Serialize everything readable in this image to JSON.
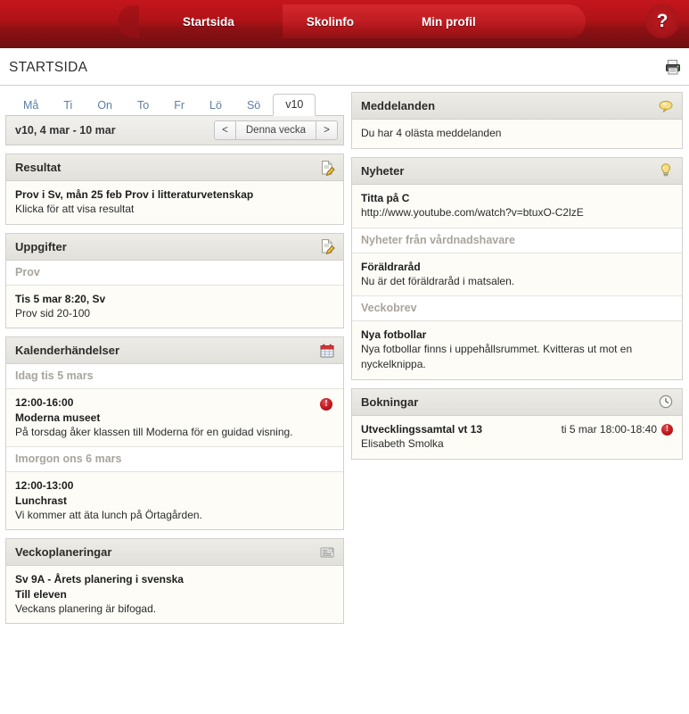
{
  "topnav": {
    "items": [
      {
        "label": "Startsida",
        "active": true
      },
      {
        "label": "Skolinfo",
        "active": false
      },
      {
        "label": "Min profil",
        "active": false
      }
    ],
    "help_label": "?"
  },
  "page": {
    "title": "STARTSIDA",
    "print_icon": "printer-icon"
  },
  "daytabs": {
    "items": [
      {
        "label": "Må"
      },
      {
        "label": "Ti"
      },
      {
        "label": "On"
      },
      {
        "label": "To"
      },
      {
        "label": "Fr"
      },
      {
        "label": "Lö"
      },
      {
        "label": "Sö"
      },
      {
        "label": "v10"
      }
    ]
  },
  "weekbar": {
    "label": "v10, 4 mar - 10 mar",
    "prev": "<",
    "current": "Denna vecka",
    "next": ">"
  },
  "panels": {
    "resultat": {
      "title": "Resultat",
      "icon": "edit-document-icon",
      "item_title": "Prov i Sv, mån 25 feb Prov i litteraturvetenskap",
      "item_text": "Klicka för att visa resultat"
    },
    "uppgifter": {
      "title": "Uppgifter",
      "icon": "edit-document-icon",
      "group_label": "Prov",
      "item_title": "Tis 5 mar 8:20, Sv",
      "item_text": "Prov sid 20-100"
    },
    "kalender": {
      "title": "Kalenderhändelser",
      "icon": "calendar-icon",
      "groups": [
        {
          "label": "Idag tis 5 mars",
          "events": [
            {
              "time": "12:00-16:00",
              "title": "Moderna museet",
              "text": "På torsdag åker klassen till Moderna för en guidad visning.",
              "badge": "!"
            }
          ]
        },
        {
          "label": "Imorgon ons 6 mars",
          "events": [
            {
              "time": "12:00-13:00",
              "title": "Lunchrast",
              "text": "Vi kommer att äta lunch på Örtagården.",
              "badge": ""
            }
          ]
        }
      ]
    },
    "veckoplaneringar": {
      "title": "Veckoplaneringar",
      "icon": "planning-document-icon",
      "item_title": "Sv 9A - Årets planering i svenska",
      "item_sub": "Till eleven",
      "item_text": "Veckans planering är bifogad."
    },
    "meddelanden": {
      "title": "Meddelanden",
      "icon": "speech-bubble-icon",
      "item_text": "Du har 4 olästa meddelanden"
    },
    "nyheter": {
      "title": "Nyheter",
      "icon": "lightbulb-icon",
      "items": [
        {
          "type": "news",
          "title": "Titta på C",
          "text": "http://www.youtube.com/watch?v=btuxO-C2lzE"
        },
        {
          "type": "group",
          "label": "Nyheter från vårdnadshavare"
        },
        {
          "type": "news",
          "title": "Föräldraråd",
          "text": "Nu är det föräldraråd i matsalen."
        },
        {
          "type": "group",
          "label": "Veckobrev"
        },
        {
          "type": "news",
          "title": "Nya fotbollar",
          "text": "Nya fotbollar finns i uppehållsrummet. Kvitteras ut mot en nyckelknippa."
        }
      ]
    },
    "bokningar": {
      "title": "Bokningar",
      "icon": "clock-icon",
      "item_title": "Utvecklingssamtal vt 13",
      "item_time": "ti 5 mar 18:00-18:40",
      "item_person": "Elisabeth Smolka",
      "badge": "!"
    }
  },
  "colors": {
    "brand_red": "#b01318",
    "nav_active": "#c21e23",
    "link_blue": "#5b7fa6",
    "panel_head": "#e7e5e0",
    "alert_red": "#c21a20",
    "icon_yellow": "#f2d86a"
  }
}
